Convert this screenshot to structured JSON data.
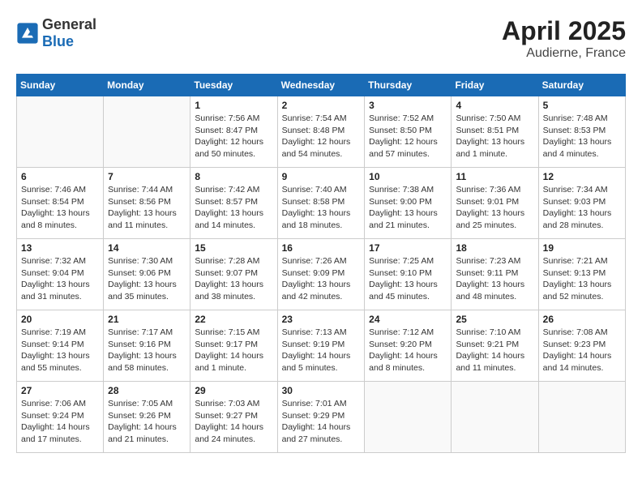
{
  "header": {
    "logo_general": "General",
    "logo_blue": "Blue",
    "month_title": "April 2025",
    "location": "Audierne, France"
  },
  "weekdays": [
    "Sunday",
    "Monday",
    "Tuesday",
    "Wednesday",
    "Thursday",
    "Friday",
    "Saturday"
  ],
  "weeks": [
    [
      {
        "day": "",
        "info": ""
      },
      {
        "day": "",
        "info": ""
      },
      {
        "day": "1",
        "info": "Sunrise: 7:56 AM\nSunset: 8:47 PM\nDaylight: 12 hours and 50 minutes."
      },
      {
        "day": "2",
        "info": "Sunrise: 7:54 AM\nSunset: 8:48 PM\nDaylight: 12 hours and 54 minutes."
      },
      {
        "day": "3",
        "info": "Sunrise: 7:52 AM\nSunset: 8:50 PM\nDaylight: 12 hours and 57 minutes."
      },
      {
        "day": "4",
        "info": "Sunrise: 7:50 AM\nSunset: 8:51 PM\nDaylight: 13 hours and 1 minute."
      },
      {
        "day": "5",
        "info": "Sunrise: 7:48 AM\nSunset: 8:53 PM\nDaylight: 13 hours and 4 minutes."
      }
    ],
    [
      {
        "day": "6",
        "info": "Sunrise: 7:46 AM\nSunset: 8:54 PM\nDaylight: 13 hours and 8 minutes."
      },
      {
        "day": "7",
        "info": "Sunrise: 7:44 AM\nSunset: 8:56 PM\nDaylight: 13 hours and 11 minutes."
      },
      {
        "day": "8",
        "info": "Sunrise: 7:42 AM\nSunset: 8:57 PM\nDaylight: 13 hours and 14 minutes."
      },
      {
        "day": "9",
        "info": "Sunrise: 7:40 AM\nSunset: 8:58 PM\nDaylight: 13 hours and 18 minutes."
      },
      {
        "day": "10",
        "info": "Sunrise: 7:38 AM\nSunset: 9:00 PM\nDaylight: 13 hours and 21 minutes."
      },
      {
        "day": "11",
        "info": "Sunrise: 7:36 AM\nSunset: 9:01 PM\nDaylight: 13 hours and 25 minutes."
      },
      {
        "day": "12",
        "info": "Sunrise: 7:34 AM\nSunset: 9:03 PM\nDaylight: 13 hours and 28 minutes."
      }
    ],
    [
      {
        "day": "13",
        "info": "Sunrise: 7:32 AM\nSunset: 9:04 PM\nDaylight: 13 hours and 31 minutes."
      },
      {
        "day": "14",
        "info": "Sunrise: 7:30 AM\nSunset: 9:06 PM\nDaylight: 13 hours and 35 minutes."
      },
      {
        "day": "15",
        "info": "Sunrise: 7:28 AM\nSunset: 9:07 PM\nDaylight: 13 hours and 38 minutes."
      },
      {
        "day": "16",
        "info": "Sunrise: 7:26 AM\nSunset: 9:09 PM\nDaylight: 13 hours and 42 minutes."
      },
      {
        "day": "17",
        "info": "Sunrise: 7:25 AM\nSunset: 9:10 PM\nDaylight: 13 hours and 45 minutes."
      },
      {
        "day": "18",
        "info": "Sunrise: 7:23 AM\nSunset: 9:11 PM\nDaylight: 13 hours and 48 minutes."
      },
      {
        "day": "19",
        "info": "Sunrise: 7:21 AM\nSunset: 9:13 PM\nDaylight: 13 hours and 52 minutes."
      }
    ],
    [
      {
        "day": "20",
        "info": "Sunrise: 7:19 AM\nSunset: 9:14 PM\nDaylight: 13 hours and 55 minutes."
      },
      {
        "day": "21",
        "info": "Sunrise: 7:17 AM\nSunset: 9:16 PM\nDaylight: 13 hours and 58 minutes."
      },
      {
        "day": "22",
        "info": "Sunrise: 7:15 AM\nSunset: 9:17 PM\nDaylight: 14 hours and 1 minute."
      },
      {
        "day": "23",
        "info": "Sunrise: 7:13 AM\nSunset: 9:19 PM\nDaylight: 14 hours and 5 minutes."
      },
      {
        "day": "24",
        "info": "Sunrise: 7:12 AM\nSunset: 9:20 PM\nDaylight: 14 hours and 8 minutes."
      },
      {
        "day": "25",
        "info": "Sunrise: 7:10 AM\nSunset: 9:21 PM\nDaylight: 14 hours and 11 minutes."
      },
      {
        "day": "26",
        "info": "Sunrise: 7:08 AM\nSunset: 9:23 PM\nDaylight: 14 hours and 14 minutes."
      }
    ],
    [
      {
        "day": "27",
        "info": "Sunrise: 7:06 AM\nSunset: 9:24 PM\nDaylight: 14 hours and 17 minutes."
      },
      {
        "day": "28",
        "info": "Sunrise: 7:05 AM\nSunset: 9:26 PM\nDaylight: 14 hours and 21 minutes."
      },
      {
        "day": "29",
        "info": "Sunrise: 7:03 AM\nSunset: 9:27 PM\nDaylight: 14 hours and 24 minutes."
      },
      {
        "day": "30",
        "info": "Sunrise: 7:01 AM\nSunset: 9:29 PM\nDaylight: 14 hours and 27 minutes."
      },
      {
        "day": "",
        "info": ""
      },
      {
        "day": "",
        "info": ""
      },
      {
        "day": "",
        "info": ""
      }
    ]
  ]
}
